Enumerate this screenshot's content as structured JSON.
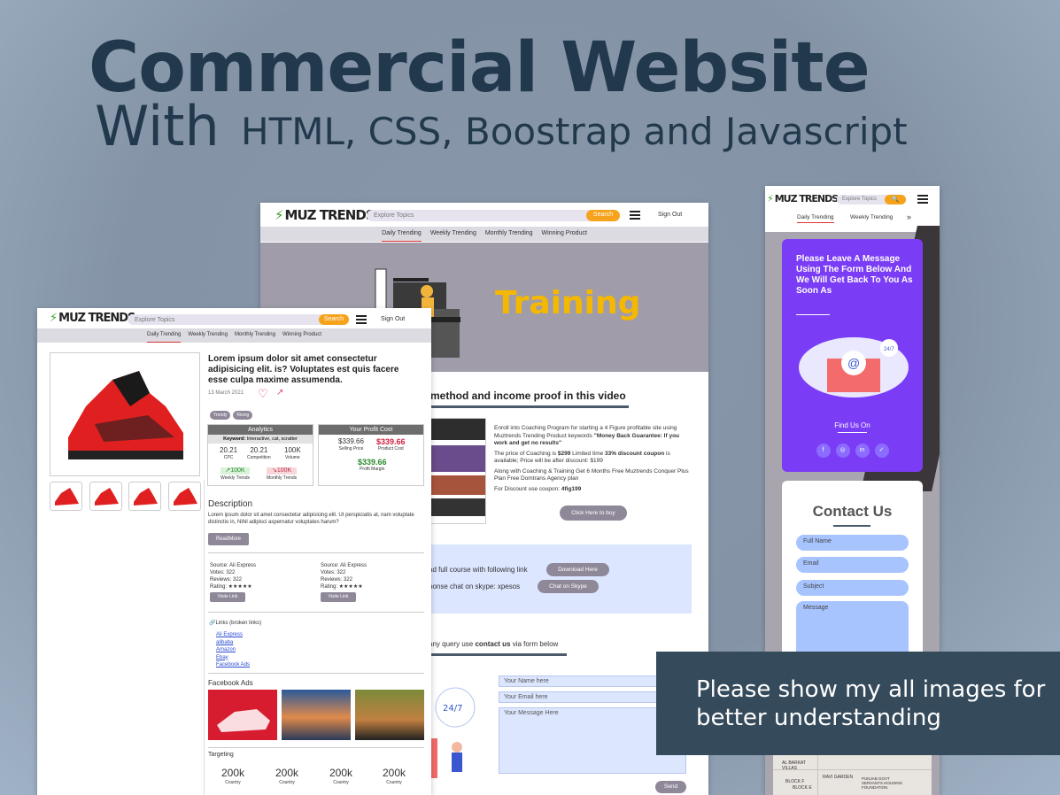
{
  "headline": {
    "line1": "Commercial Website",
    "with": "With",
    "tech": "HTML, CSS, Boostrap and Javascript"
  },
  "brand": "MUZ TRENDS",
  "search": {
    "placeholder": "Explore Topics",
    "button": "Search"
  },
  "signout": "Sign Out",
  "nav": {
    "daily": "Daily Trending",
    "weekly": "Weekly Trending",
    "monthly": "Monthly Trending",
    "winning": "Winning Product"
  },
  "training": {
    "hero": "Training",
    "section_title": "method and income proof in this video",
    "p1": "Enroll into Coaching Program for starting a 4 Figure profitable site using Muztrends Trending Product keywords",
    "p1b": "\"Money Back Guarantee: If you work and get no results\"",
    "p2a": "The price of Coaching is ",
    "p2b": "$299",
    "p2c": " Limited time ",
    "p2d": "33% discount coupon",
    "p2e": " is available; Price will be after discount: $199",
    "p3": "Along with Coaching & Training Get 6 Months Free Muztrends Conquer Plus Plan Free Domtrans Agency plan",
    "p4a": "For Discount use coupon: ",
    "p4b": "4fig199",
    "buy": "Click Here to buy",
    "dl_text": "ad full course with following link",
    "dl_btn": "Download Here",
    "skype_text": "ponse chat on skype: xpesos",
    "skype_btn": "Chat on Skype",
    "query_a": "any query use ",
    "query_b": "contact us",
    "query_c": " via form below",
    "f_name": "Your Name here",
    "f_email": "Your Email here",
    "f_msg": "Your Message Here",
    "send": "Send",
    "badge": "24/7"
  },
  "product": {
    "title": "Lorem ipsum dolor sit amet consectetur adipisicing elit. is? Voluptates est quis facere esse culpa maxime assumenda.",
    "date": "13 March 2021",
    "tags": [
      "Trendy",
      "Rising"
    ],
    "analytics": {
      "title": "Analytics",
      "keyword": "Keyword: ",
      "keywords": "Interactive, cat, scratter",
      "cpc": "20.21",
      "cpc_l": "CPC",
      "comp": "20.21",
      "comp_l": "Competition",
      "vol": "100K",
      "vol_l": "Volume",
      "wt": "100K",
      "wt_l": "Weekly Trends",
      "mt": "100K",
      "mt_l": "Monthly Trends"
    },
    "profit": {
      "title": "Your Profit Cost",
      "sell": "$339.66",
      "sell_l": "Selling Price",
      "cost": "$339.66",
      "cost_l": "Product Cost",
      "margin": "$339.66",
      "margin_l": "Profit Margin"
    },
    "desc_title": "Description",
    "desc": "Lorem ipsum dolor sit amet consectetur adipisicing elit. Ut perspiciatis at, nam voluptate distinctio in, Nihil adipisci aspernatur voluptates harum?",
    "readmore": "ReadMore",
    "source": {
      "s": "Source: Ali Express",
      "v": "Votes: 322",
      "r": "Reviews: 322",
      "rt": "Rating: ★★★★★",
      "btn": "Visite Link"
    },
    "links_title": "Links (broken links)",
    "links": [
      "Ali Express",
      "alibaba",
      "Amazon",
      "Ebay",
      "Facebook Ads"
    ],
    "fb_title": "Facebook Ads",
    "targeting": "Targeting",
    "tval": "200k",
    "tlab": "Country"
  },
  "mobile": {
    "cta": "Please Leave A Message Using The Form Below And We Will Get Back To You As Soon As",
    "find": "Find Us On",
    "social": [
      "f",
      "◎",
      "in",
      "✓"
    ],
    "contact": "Contact Us",
    "full": "Full Name",
    "email": "Email",
    "subject": "Subject",
    "message": "Message",
    "badge": "24/7",
    "map": "AL BARKAT VILLAS",
    "map2": "RAVI GARDEN",
    "map3": "PUNJAB GOVT SERVANTS HOUSING FOUNDATION",
    "map4": "BLOCK F",
    "map5": "BLOCK E"
  },
  "popup": "Please show my all images for better understanding"
}
